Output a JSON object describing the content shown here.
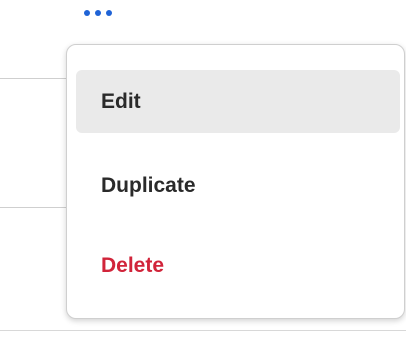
{
  "more_button": {
    "icon": "more-horizontal-icon",
    "color": "#1f63d6"
  },
  "menu": {
    "items": [
      {
        "label": "Edit",
        "state": "hovered"
      },
      {
        "label": "Duplicate"
      },
      {
        "label": "Delete",
        "color": "#d1243a"
      }
    ]
  }
}
